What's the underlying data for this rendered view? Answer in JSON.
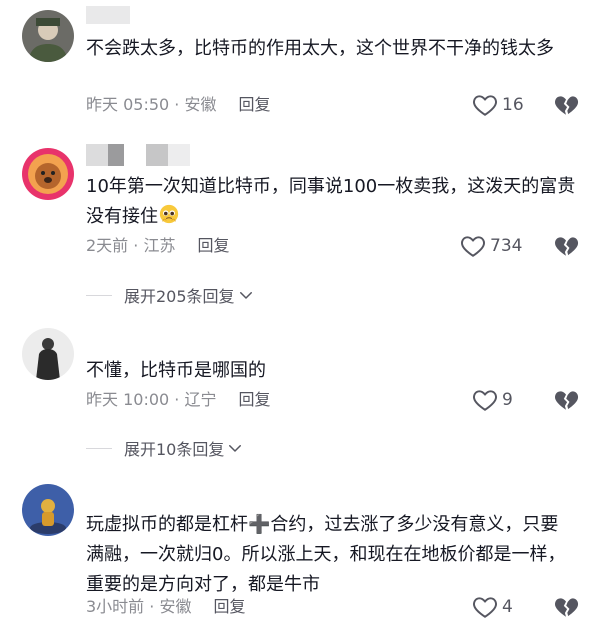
{
  "comments": [
    {
      "text": "不会跌太多，比特币的作用太大，这个世界不干净的钱太多",
      "meta": "昨天 05:50 · 安徽",
      "reply": "回复",
      "likes": "16"
    },
    {
      "text": "10年第一次知道比特币，同事说100一枚卖我，这泼天的富贵没有接住",
      "meta": "2天前 · 江苏",
      "reply": "回复",
      "likes": "734",
      "expand": "展开205条回复"
    },
    {
      "text": "不懂，比特币是哪国的",
      "meta": "昨天 10:00 · 辽宁",
      "reply": "回复",
      "likes": "9",
      "expand": "展开10条回复"
    },
    {
      "text": "玩虚拟币的都是杠杆➕合约，过去涨了多少没有意义，只要满融，一次就归0。所以涨上天，和现在在地板价都是一样，重要的是方向对了，都是牛市",
      "meta": "3小时前 · 安徽",
      "reply": "回复",
      "likes": "4"
    }
  ],
  "icons": {
    "like": "heart-outline-icon",
    "dislike": "broken-heart-icon",
    "expand": "chevron-down-icon",
    "emoji": "pleading-face-emoji"
  },
  "colors": {
    "text": "#161823",
    "meta": "#8a8b91",
    "icon": "#555660"
  }
}
